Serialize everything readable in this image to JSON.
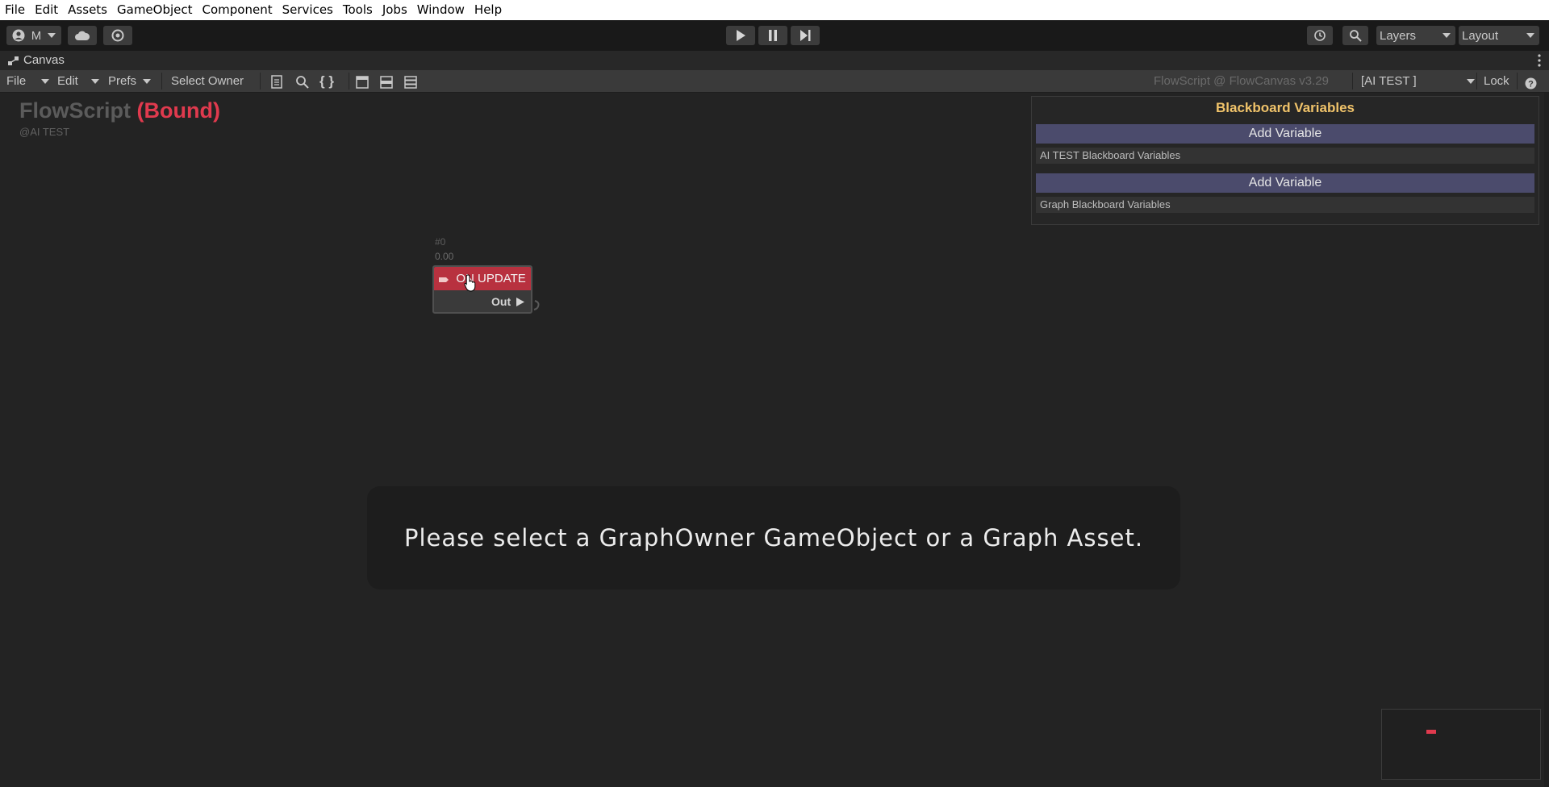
{
  "menu": [
    "File",
    "Edit",
    "Assets",
    "GameObject",
    "Component",
    "Services",
    "Tools",
    "Jobs",
    "Window",
    "Help"
  ],
  "toolbar": {
    "account_label": "M",
    "layers_label": "Layers",
    "layout_label": "Layout"
  },
  "tab": {
    "title": "Canvas"
  },
  "editor_toolbar": {
    "file": "File",
    "edit": "Edit",
    "prefs": "Prefs",
    "select_owner": "Select Owner",
    "version": "FlowScript @ FlowCanvas v3.29",
    "target": "[AI TEST ]",
    "lock": "Lock"
  },
  "graph": {
    "title": "FlowScript",
    "bound": "(Bound)",
    "owner": "@AI TEST"
  },
  "node": {
    "index": "#0",
    "time": "0.00",
    "title": "ON UPDATE",
    "out_port": "Out"
  },
  "blackboard": {
    "title": "Blackboard Variables",
    "add_label_1": "Add Variable",
    "section_1": "AI TEST  Blackboard Variables",
    "add_label_2": "Add Variable",
    "section_2": "Graph Blackboard Variables"
  },
  "message": "Please select a GraphOwner GameObject or a Graph Asset."
}
